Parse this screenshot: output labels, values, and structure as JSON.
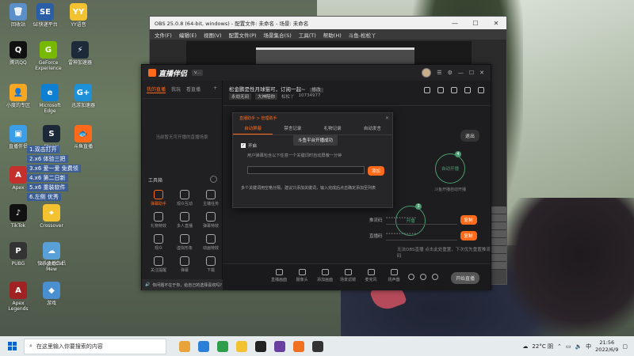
{
  "desktop": {
    "icons": [
      {
        "label": "回收站",
        "color": "#5a8fc9",
        "glyph": "🗑"
      },
      {
        "label": "SE快递平台",
        "color": "#2a5fa8",
        "glyph": "SE"
      },
      {
        "label": "YY语音",
        "color": "#f2c230",
        "glyph": "YY"
      },
      {
        "label": "腾讯QQ",
        "color": "#111111",
        "glyph": "Q"
      },
      {
        "label": "GeForce Experience",
        "color": "#76b900",
        "glyph": "G"
      },
      {
        "label": "雷神加速器",
        "color": "#1c2a3a",
        "glyph": "⚡"
      },
      {
        "label": "小度的专区",
        "color": "#f5a623",
        "glyph": "👤"
      },
      {
        "label": "Microsoft Edge",
        "color": "#0f7fd1",
        "glyph": "e"
      },
      {
        "label": "迅游加速器",
        "color": "#1e90d8",
        "glyph": "G+"
      },
      {
        "label": "直播伴侣",
        "color": "#3b9ee8",
        "glyph": "▣"
      },
      {
        "label": "Steam",
        "color": "#1b2838",
        "glyph": "S"
      },
      {
        "label": "斗鱼直播",
        "color": "#ff6a1a",
        "glyph": "🐟"
      },
      {
        "label": "Apex",
        "color": "#c4302b",
        "glyph": "A"
      },
      {
        "label": "TikTok",
        "color": "#111111",
        "glyph": "♪"
      },
      {
        "label": "Crossover",
        "color": "#f2c230",
        "glyph": "⌖"
      },
      {
        "label": "快手直播伴侣",
        "color": "#ff5a2a",
        "glyph": "▶"
      },
      {
        "label": "PUBG",
        "color": "#333333",
        "glyph": "P"
      },
      {
        "label": "Bright Cat Mew",
        "color": "#5aa0d8",
        "glyph": "☁"
      },
      {
        "label": "Apex Legends",
        "color": "#a02222",
        "glyph": "A"
      },
      {
        "label": "游戏",
        "color": "#4a8fd0",
        "glyph": "◆"
      }
    ],
    "overlay_texts": [
      "1.双击打开",
      "2.x6 体验三把",
      "3.x6 爱一爱 免费领",
      "4.x6 第二日新",
      "5.x6 重装软件",
      "6.左侧 优秀"
    ]
  },
  "obs": {
    "title": "OBS 25.0.8 (64-bit, windows) - 配置文件: 未命名 - 场景: 未命名",
    "menu": [
      "文件(F)",
      "编辑(E)",
      "视图(V)",
      "配置文件(P)",
      "场景集合(S)",
      "工具(T)",
      "帮助(H)",
      "斗鱼-松松丫"
    ]
  },
  "app": {
    "name": "直播伴侣",
    "version": "v...",
    "left_tabs": [
      "我的直播",
      "我玩",
      "看直播"
    ],
    "empty_note": "当前暂无可开播的直播场景",
    "tools_header": "工具箱",
    "tools": [
      {
        "label": "弹幕助手",
        "hot": true
      },
      {
        "label": "观众互动"
      },
      {
        "label": "主播任务"
      },
      {
        "label": "礼物特效"
      },
      {
        "label": "多人直播"
      },
      {
        "label": "弹幕特效"
      },
      {
        "label": "观众"
      },
      {
        "label": "虚拟形象"
      },
      {
        "label": "动画特效"
      },
      {
        "label": "关注提醒"
      },
      {
        "label": "弹幕"
      },
      {
        "label": "下载"
      }
    ],
    "notice": "你问题不在于你，给自己的选择喜欢吗?",
    "room_title": "松金鹏是性月球猫可，订阅一起~",
    "edit_label": "修改",
    "room_meta": [
      "永劫无间",
      "大神陪你",
      "松松丫",
      "10734977"
    ],
    "exit_label": "退出",
    "circle_left": {
      "label": "开播",
      "badge": "3",
      "caption": "手动开播"
    },
    "circle_right": {
      "label": "自动开播",
      "badge": "4",
      "caption": "斗鱼开播自动开播"
    },
    "code_rows": [
      {
        "label": "推流码",
        "value": "••••••••••••",
        "btn": "复制"
      },
      {
        "label": "直播码",
        "value": "••••••••••••",
        "btn": "复制"
      }
    ],
    "hint": "无法OBS直播 点击此处重置，下次优先重置推流码",
    "bottom_items": [
      "直播画面",
      "摄像头",
      "添加画面",
      "场景滤镜",
      "麦克风",
      "扬声器"
    ],
    "start_label": "开始直播"
  },
  "dialog": {
    "breadcrumb": "直播助手 > 管理助手",
    "tabs": [
      "自动屏蔽",
      "禁言记录",
      "礼物记录",
      "自动发言"
    ],
    "tooltip": "斗鱼平台开播成功",
    "checkbox_label": "开启",
    "description": "用户弹幕包含以下任意一个关键词时自动屏蔽一分钟",
    "add_label": "添加",
    "footer": "多个关键词用空格分隔，建议只添加关键词，输入完成后点击确定添加至列表"
  },
  "taskbar": {
    "search_placeholder": "在这里输入你要搜索的内容",
    "weather": "22°C 阴",
    "lang": "中",
    "time": "21:56",
    "date": "2022/6/9",
    "colors": [
      "#e8a33a",
      "#2b7fd6",
      "#2e9e4c",
      "#f2c230",
      "#222222",
      "#6b3fa0",
      "#f07020",
      "#333333"
    ]
  }
}
